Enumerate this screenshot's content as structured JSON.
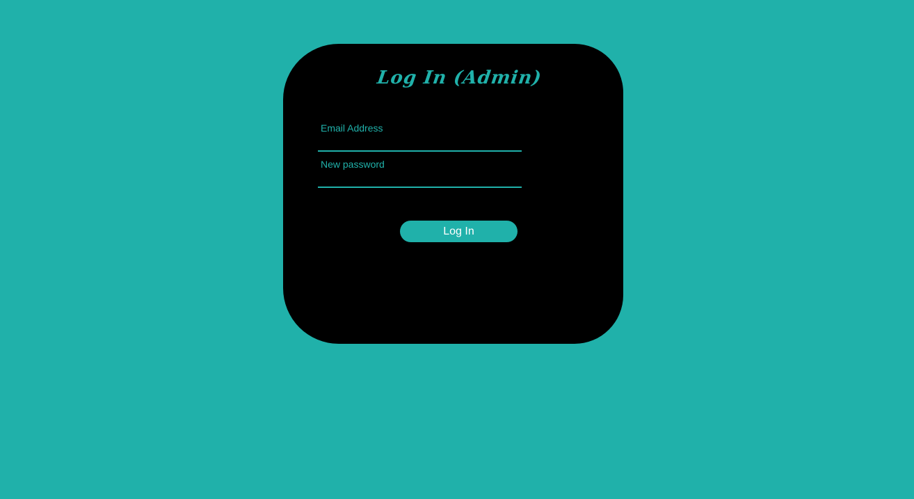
{
  "page": {
    "background_color": "#20B1AA",
    "card_color": "#000000"
  },
  "login": {
    "title": "Log In (Admin)",
    "email": {
      "placeholder": "Email Address",
      "value": ""
    },
    "password": {
      "placeholder": "New password",
      "value": ""
    },
    "submit_label": "Log In"
  }
}
